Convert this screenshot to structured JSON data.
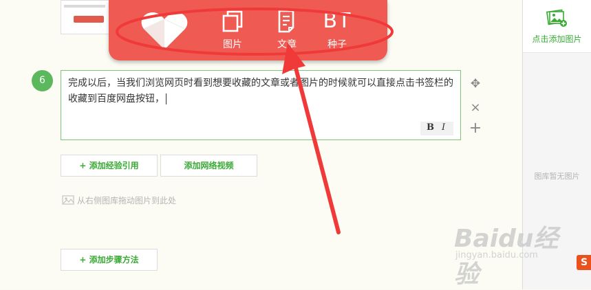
{
  "right_panel": {
    "add_image_label": "点击添加图片",
    "empty_label": "图库暂无图片",
    "add_icon": "image-add-icon"
  },
  "popup": {
    "logo_icon": "heart-logo-icon",
    "items": [
      {
        "label": "图片",
        "icon": "image-frame-icon"
      },
      {
        "label": "文章",
        "icon": "document-icon"
      },
      {
        "label": "种子",
        "icon": "bt-text-icon",
        "glyph": "BT"
      }
    ]
  },
  "step": {
    "number": "6",
    "text": "完成以后，当我们浏览网页时看到想要收藏的文章或者图片的时候就可以直接点击书签栏的收藏到百度网盘按钮，",
    "format_bold": "B",
    "format_italic": "I"
  },
  "tools": {
    "move": "✥",
    "delete": "×",
    "add": "+"
  },
  "buttons": {
    "add_reference": "+ 添加经验引用",
    "add_video": "添加网络视频",
    "add_step_method": "+ 添加步骤方法"
  },
  "drag_hint": "从右侧图库拖动图片到此处",
  "watermark": {
    "brand": "Baidu经验",
    "url": "jingyan.baidu.com"
  },
  "corner_logo": "S",
  "colors": {
    "accent_green": "#3aaa35",
    "popup_red": "#ef5a52",
    "annotation_red": "#f03a3a"
  }
}
